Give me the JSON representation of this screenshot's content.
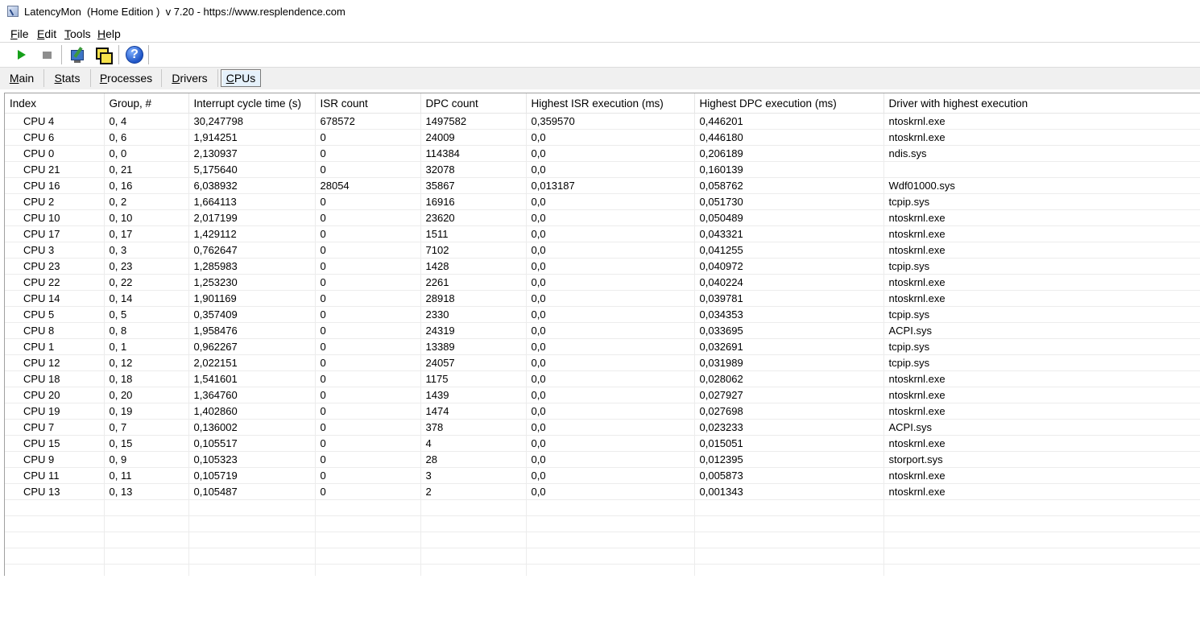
{
  "window": {
    "title": "LatencyMon  (Home Edition )  v 7.20 - https://www.resplendence.com"
  },
  "menu": [
    {
      "first": "F",
      "rest": "ile"
    },
    {
      "first": "E",
      "rest": "dit"
    },
    {
      "first": "T",
      "rest": "ools"
    },
    {
      "first": "H",
      "rest": "elp"
    }
  ],
  "toolbar": {
    "icons": [
      "play-icon",
      "stop-icon",
      "monitor-icon",
      "windows-icon",
      "help-icon"
    ],
    "help_glyph": "?"
  },
  "tabs": [
    {
      "first": "M",
      "rest": "ain",
      "active": false
    },
    {
      "first": "S",
      "rest": "tats",
      "active": false
    },
    {
      "first": "P",
      "rest": "rocesses",
      "active": false
    },
    {
      "first": "D",
      "rest": "rivers",
      "active": false
    },
    {
      "first": "C",
      "rest": "PUs",
      "active": true
    }
  ],
  "table": {
    "columns": [
      "Index",
      "Group, #",
      "Interrupt cycle time (s)",
      "ISR count",
      "DPC count",
      "Highest ISR execution (ms)",
      "Highest DPC execution (ms)",
      "Driver with highest execution"
    ],
    "rows": [
      [
        "CPU 4",
        "0, 4",
        "30,247798",
        "678572",
        "1497582",
        "0,359570",
        "0,446201",
        "ntoskrnl.exe"
      ],
      [
        "CPU 6",
        "0, 6",
        "1,914251",
        "0",
        "24009",
        "0,0",
        "0,446180",
        "ntoskrnl.exe"
      ],
      [
        "CPU 0",
        "0, 0",
        "2,130937",
        "0",
        "114384",
        "0,0",
        "0,206189",
        "ndis.sys"
      ],
      [
        "CPU 21",
        "0, 21",
        "5,175640",
        "0",
        "32078",
        "0,0",
        "0,160139",
        ""
      ],
      [
        "CPU 16",
        "0, 16",
        "6,038932",
        "28054",
        "35867",
        "0,013187",
        "0,058762",
        "Wdf01000.sys"
      ],
      [
        "CPU 2",
        "0, 2",
        "1,664113",
        "0",
        "16916",
        "0,0",
        "0,051730",
        "tcpip.sys"
      ],
      [
        "CPU 10",
        "0, 10",
        "2,017199",
        "0",
        "23620",
        "0,0",
        "0,050489",
        "ntoskrnl.exe"
      ],
      [
        "CPU 17",
        "0, 17",
        "1,429112",
        "0",
        "1511",
        "0,0",
        "0,043321",
        "ntoskrnl.exe"
      ],
      [
        "CPU 3",
        "0, 3",
        "0,762647",
        "0",
        "7102",
        "0,0",
        "0,041255",
        "ntoskrnl.exe"
      ],
      [
        "CPU 23",
        "0, 23",
        "1,285983",
        "0",
        "1428",
        "0,0",
        "0,040972",
        "tcpip.sys"
      ],
      [
        "CPU 22",
        "0, 22",
        "1,253230",
        "0",
        "2261",
        "0,0",
        "0,040224",
        "ntoskrnl.exe"
      ],
      [
        "CPU 14",
        "0, 14",
        "1,901169",
        "0",
        "28918",
        "0,0",
        "0,039781",
        "ntoskrnl.exe"
      ],
      [
        "CPU 5",
        "0, 5",
        "0,357409",
        "0",
        "2330",
        "0,0",
        "0,034353",
        "tcpip.sys"
      ],
      [
        "CPU 8",
        "0, 8",
        "1,958476",
        "0",
        "24319",
        "0,0",
        "0,033695",
        "ACPI.sys"
      ],
      [
        "CPU 1",
        "0, 1",
        "0,962267",
        "0",
        "13389",
        "0,0",
        "0,032691",
        "tcpip.sys"
      ],
      [
        "CPU 12",
        "0, 12",
        "2,022151",
        "0",
        "24057",
        "0,0",
        "0,031989",
        "tcpip.sys"
      ],
      [
        "CPU 18",
        "0, 18",
        "1,541601",
        "0",
        "1175",
        "0,0",
        "0,028062",
        "ntoskrnl.exe"
      ],
      [
        "CPU 20",
        "0, 20",
        "1,364760",
        "0",
        "1439",
        "0,0",
        "0,027927",
        "ntoskrnl.exe"
      ],
      [
        "CPU 19",
        "0, 19",
        "1,402860",
        "0",
        "1474",
        "0,0",
        "0,027698",
        "ntoskrnl.exe"
      ],
      [
        "CPU 7",
        "0, 7",
        "0,136002",
        "0",
        "378",
        "0,0",
        "0,023233",
        "ACPI.sys"
      ],
      [
        "CPU 15",
        "0, 15",
        "0,105517",
        "0",
        "4",
        "0,0",
        "0,015051",
        "ntoskrnl.exe"
      ],
      [
        "CPU 9",
        "0, 9",
        "0,105323",
        "0",
        "28",
        "0,0",
        "0,012395",
        "storport.sys"
      ],
      [
        "CPU 11",
        "0, 11",
        "0,105719",
        "0",
        "3",
        "0,0",
        "0,005873",
        "ntoskrnl.exe"
      ],
      [
        "CPU 13",
        "0, 13",
        "0,105487",
        "0",
        "2",
        "0,0",
        "0,001343",
        "ntoskrnl.exe"
      ]
    ]
  }
}
